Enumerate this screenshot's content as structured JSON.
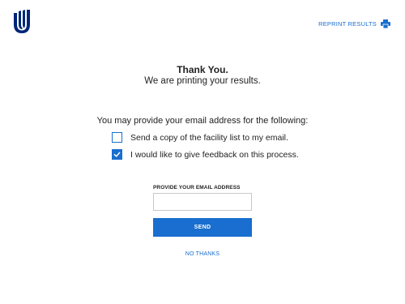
{
  "header": {
    "logo_icon": "united-healthcare-u-logo-icon",
    "reprint_label": "REPRINT RESULTS",
    "reprint_icon": "printer-icon"
  },
  "message": {
    "title": "Thank You.",
    "subtitle": "We are printing your results."
  },
  "email_options": {
    "prompt": "You may provide your email address for the following:",
    "options": [
      {
        "label": "Send a copy of the facility list to my email.",
        "checked": false
      },
      {
        "label": "I would like to give feedback on this process.",
        "checked": true
      }
    ]
  },
  "email_form": {
    "field_label": "PROVIDE YOUR EMAIL ADDRESS",
    "value": "",
    "send_label": "SEND",
    "no_thanks_label": "NO THANKS"
  },
  "colors": {
    "accent": "#196ECF",
    "logo": "#002677",
    "text": "#222222"
  }
}
